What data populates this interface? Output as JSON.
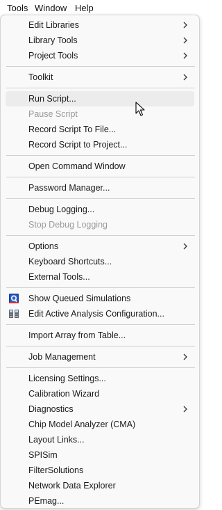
{
  "menubar": {
    "tools": "Tools",
    "window": "Window",
    "help": "Help"
  },
  "menu": {
    "edit_libraries": "Edit Libraries",
    "library_tools": "Library Tools",
    "project_tools": "Project Tools",
    "toolkit": "Toolkit",
    "run_script": "Run Script...",
    "pause_script": "Pause Script",
    "record_script_to_file": "Record Script To File...",
    "record_script_to_project": "Record Script to Project...",
    "open_command_window": "Open Command Window",
    "password_manager": "Password Manager...",
    "debug_logging": "Debug Logging...",
    "stop_debug_logging": "Stop Debug Logging",
    "options": "Options",
    "keyboard_shortcuts": "Keyboard Shortcuts...",
    "external_tools": "External Tools...",
    "show_queued_simulations": "Show Queued Simulations",
    "edit_active_analysis_configuration": "Edit Active Analysis Configuration...",
    "import_array_from_table": "Import Array from Table...",
    "job_management": "Job Management",
    "licensing_settings": "Licensing Settings...",
    "calibration_wizard": "Calibration Wizard",
    "diagnostics": "Diagnostics",
    "chip_model_analyzer": "Chip Model Analyzer (CMA)",
    "layout_links": "Layout Links...",
    "spisim": "SPISim",
    "filtersolutions": "FilterSolutions",
    "network_data_explorer": "Network Data Explorer",
    "pemag": "PEmag..."
  },
  "icons": {
    "submenu": "chevron-right-icon",
    "queued": "queued-simulations-icon",
    "analysis_config": "analysis-configuration-icon",
    "pointer": "mouse-pointer-icon"
  },
  "colors": {
    "hover_bg": "#ececec",
    "disabled_text": "#9a9a9a"
  }
}
